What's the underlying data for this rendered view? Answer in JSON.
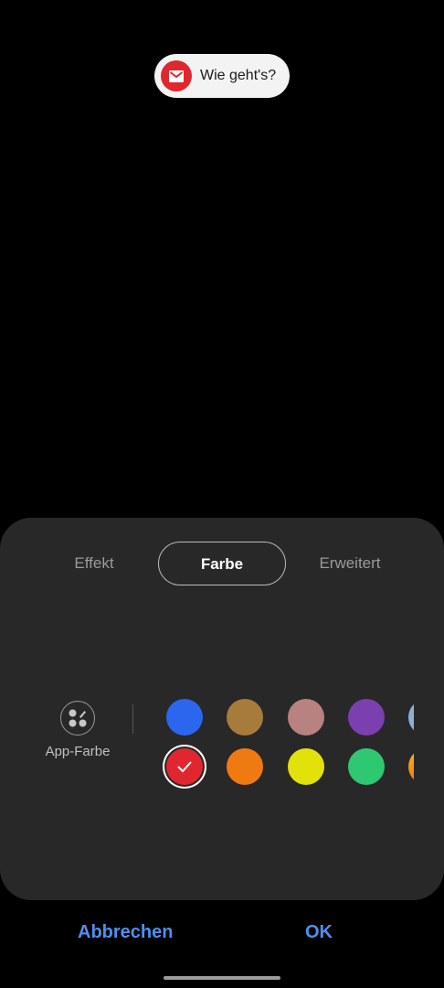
{
  "preview": {
    "message": "Wie geht's?",
    "icon": "mail-icon",
    "icon_color": "#e0262e"
  },
  "tabs": [
    {
      "label": "Effekt",
      "active": false
    },
    {
      "label": "Farbe",
      "active": true
    },
    {
      "label": "Erweitert",
      "active": false
    }
  ],
  "app_color": {
    "label": "App-Farbe",
    "icon": "palette-icon"
  },
  "swatches": [
    {
      "name": "blue",
      "color": "#2a66ee",
      "selected": false
    },
    {
      "name": "bronze",
      "color": "#a77c3b",
      "selected": false
    },
    {
      "name": "rose-brown",
      "color": "#b7827f",
      "selected": false
    },
    {
      "name": "purple",
      "color": "#7b3fb0",
      "selected": false
    },
    {
      "name": "light-blue",
      "color": "#8ab0d6",
      "selected": false
    },
    {
      "name": "red",
      "color": "#e0262e",
      "selected": true
    },
    {
      "name": "orange",
      "color": "#f07a12",
      "selected": false
    },
    {
      "name": "yellow",
      "color": "#e2e20a",
      "selected": false
    },
    {
      "name": "green",
      "color": "#2ec873",
      "selected": false
    },
    {
      "name": "orange-gradient",
      "color": "#f4a21a",
      "selected": false
    }
  ],
  "buttons": {
    "cancel": "Abbrechen",
    "ok": "OK"
  }
}
